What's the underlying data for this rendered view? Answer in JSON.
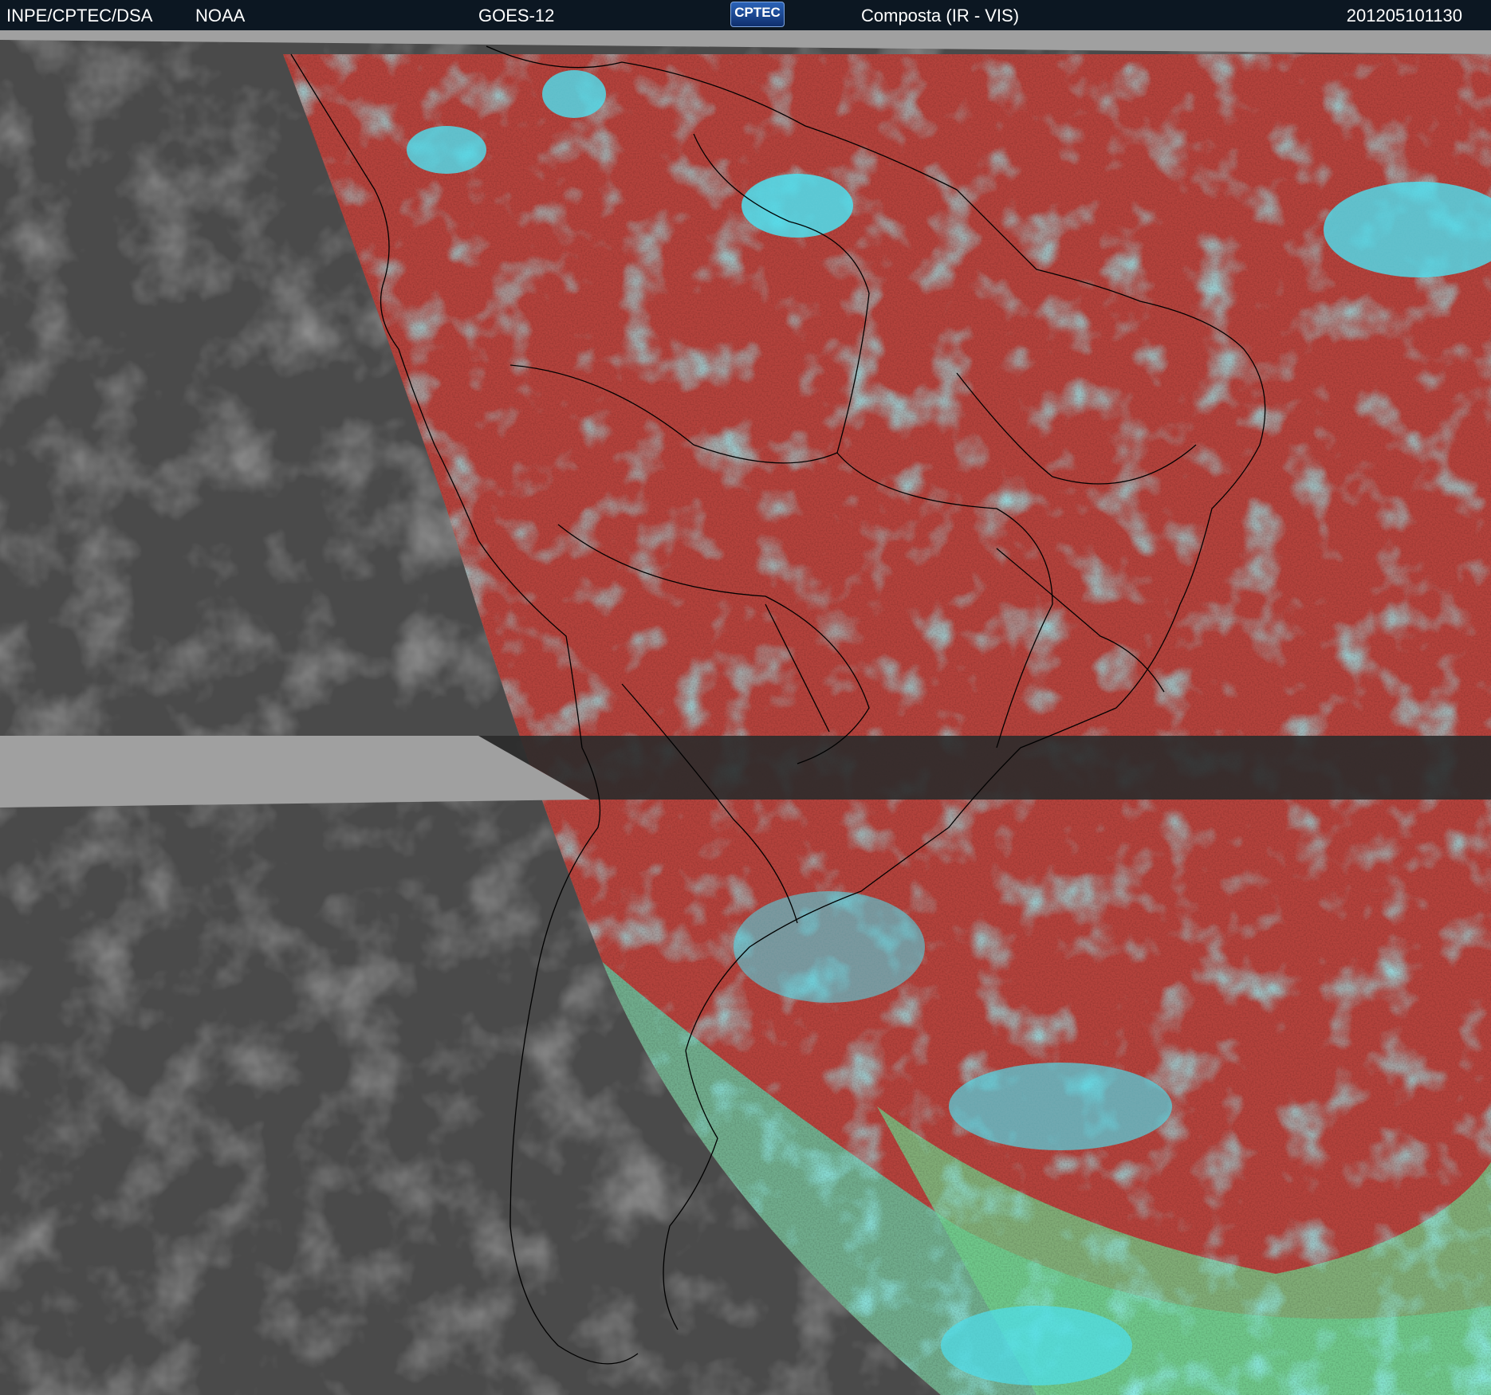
{
  "header": {
    "institution": "INPE/CPTEC/DSA",
    "agency": "NOAA",
    "satellite": "GOES-12",
    "logo_text": "CPTEC",
    "product": "Composta (IR - VIS)",
    "timestamp": "201205101130"
  },
  "colors": {
    "header_bg": "#0c1722",
    "ir_gray": "#4a4a4a",
    "land_red": "#b4423c",
    "ocean_green": "#8fd66a",
    "cloud_cyan": "#40e0f0",
    "gap_gray": "#a0a0a0",
    "coastline": "#000000"
  }
}
